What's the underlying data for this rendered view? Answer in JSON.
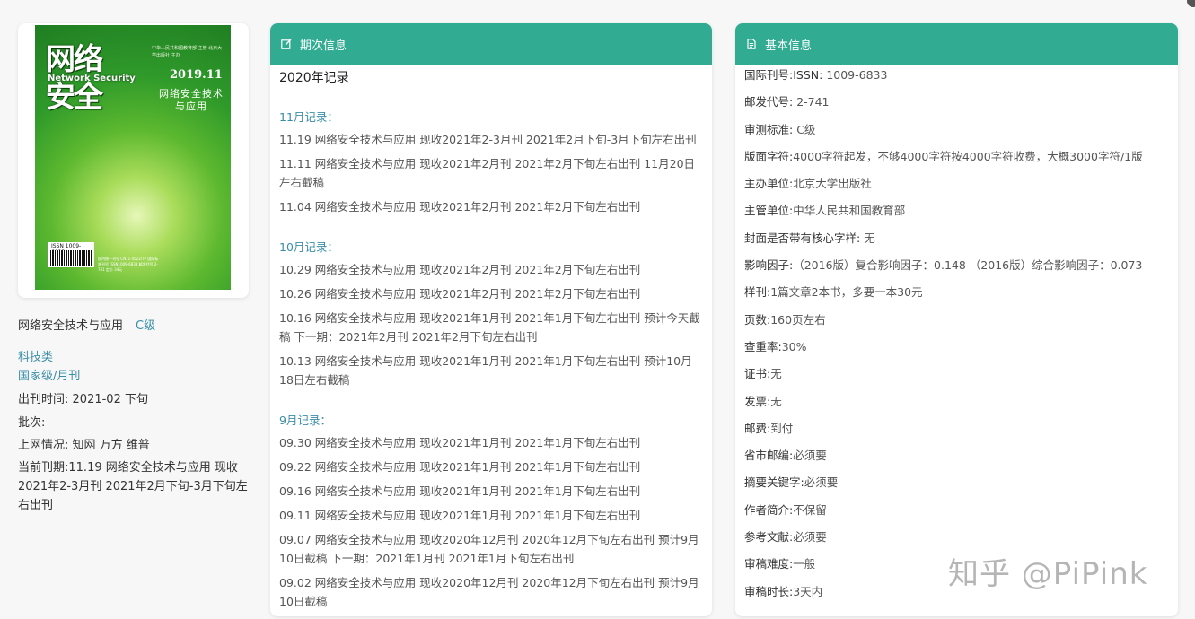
{
  "cover": {
    "title_line1": "网络",
    "title_line2": "安全",
    "title_en": "Network Security",
    "date": "2019.11",
    "subtitle": "网络安全技术与应用",
    "publisher_small": "中华人民共和国教育部 主管 北京大学出版社 主办",
    "issn_label": "ISSN 1009-6833",
    "print_info": "国内统一刊号 CN11-4522/TP 国际标准刊号 ISSN1009-6833 邮发代号 2-741 定价 34元"
  },
  "left": {
    "journal_name": "网络安全技术与应用",
    "level": "C级",
    "category": "科技类",
    "grade": "国家级/月刊",
    "pub_time_label": "出刊时间:",
    "pub_time_value": " 2021-02 下旬",
    "batch_label": "批次:",
    "online_label": "上网情况:",
    "online_value": " 知网 万方 维普",
    "current_label": "当前刊期:",
    "current_value": "11.19 网络安全技术与应用 现收2021年2-3月刊 2021年2月下旬-3月下旬左右出刊"
  },
  "issue_card": {
    "header": "期次信息",
    "year_title": "2020年记录",
    "months": [
      {
        "label": "11月记录：",
        "records": [
          "11.19 网络安全技术与应用 现收2021年2-3月刊 2021年2月下旬-3月下旬左右出刊",
          "11.11 网络安全技术与应用 现收2021年2月刊 2021年2月下旬左右出刊 11月20日左右截稿",
          "11.04 网络安全技术与应用 现收2021年2月刊 2021年2月下旬左右出刊"
        ]
      },
      {
        "label": "10月记录：",
        "records": [
          "10.29 网络安全技术与应用 现收2021年2月刊 2021年2月下旬左右出刊",
          "10.26 网络安全技术与应用 现收2021年2月刊 2021年2月下旬左右出刊",
          "10.16 网络安全技术与应用 现收2021年1月刊 2021年1月下旬左右出刊 预计今天截稿 下一期：2021年2月刊 2021年2月下旬左右出刊",
          "10.13 网络安全技术与应用 现收2021年1月刊 2021年1月下旬左右出刊 预计10月18日左右截稿"
        ]
      },
      {
        "label": "9月记录：",
        "records": [
          "09.30 网络安全技术与应用 现收2021年1月刊 2021年1月下旬左右出刊",
          "09.22 网络安全技术与应用 现收2021年1月刊 2021年1月下旬左右出刊",
          "09.16 网络安全技术与应用 现收2021年1月刊 2021年1月下旬左右出刊",
          "09.11 网络安全技术与应用 现收2021年1月刊 2021年1月下旬左右出刊",
          "09.07 网络安全技术与应用 现收2020年12月刊 2020年12月下旬左右出刊 预计9月10日截稿 下一期：2021年1月刊 2021年1月下旬左右出刊",
          "09.02 网络安全技术与应用 现收2020年12月刊 2020年12月下旬左右出刊 预计9月10日截稿"
        ]
      }
    ]
  },
  "basic_card": {
    "header": "基本信息",
    "rows": [
      {
        "k": "国际刊号:ISSN:",
        "v": " 1009-6833"
      },
      {
        "k": "邮发代号:",
        "v": " 2-741"
      },
      {
        "k": "审测标准:",
        "v": " C级"
      },
      {
        "k": "版面字符:",
        "v": "4000字符起发，不够4000字符按4000字符收费，大概3000字符/1版"
      },
      {
        "k": "主办单位:",
        "v": "北京大学出版社"
      },
      {
        "k": "主管单位:",
        "v": "中华人民共和国教育部"
      },
      {
        "k": "封面是否带有核心字样:",
        "v": " 无"
      },
      {
        "k": "影响因子:",
        "v": "（2016版）复合影响因子：0.148 （2016版）综合影响因子：0.073"
      },
      {
        "k": "样刊:",
        "v": "1篇文章2本书，多要一本30元"
      },
      {
        "k": "页数:",
        "v": "160页左右"
      },
      {
        "k": "查重率:",
        "v": "30%"
      },
      {
        "k": "证书:",
        "v": "无"
      },
      {
        "k": "发票:",
        "v": "无"
      },
      {
        "k": "邮费:",
        "v": "到付"
      },
      {
        "k": "省市邮编:",
        "v": "必须要"
      },
      {
        "k": "摘要关键字:",
        "v": "必须要"
      },
      {
        "k": "作者简介:",
        "v": "不保留"
      },
      {
        "k": "参考文献:",
        "v": "必须要"
      },
      {
        "k": "审稿难度:",
        "v": "一般"
      },
      {
        "k": "审稿时长:",
        "v": "3天内"
      }
    ]
  },
  "watermark": "知乎 @PiPink",
  "colors": {
    "header_bg": "#31ab92",
    "link": "#3a8ea6"
  }
}
